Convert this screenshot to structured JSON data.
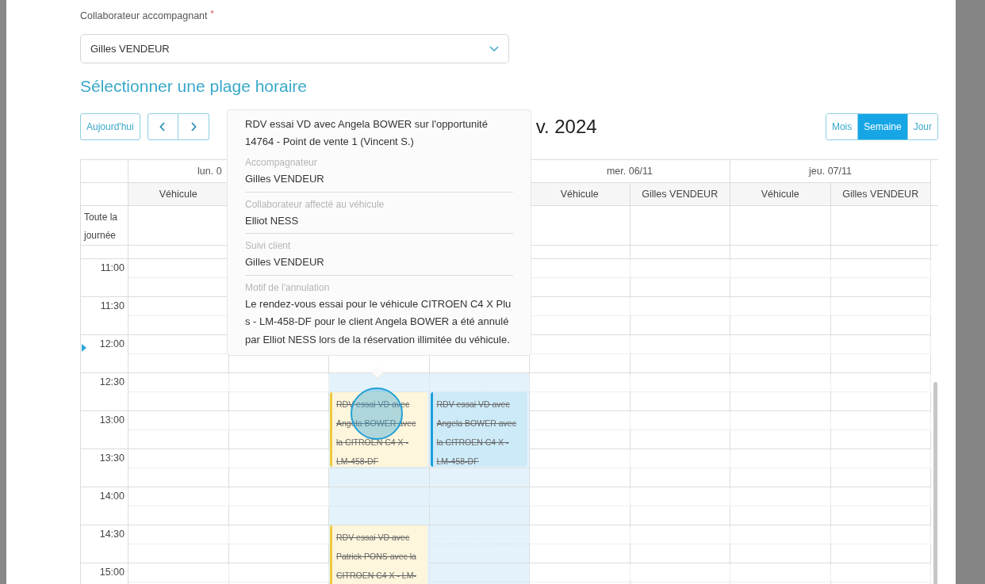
{
  "form": {
    "label": "Collaborateur accompagnant",
    "required_mark": "*",
    "select_value": "Gilles VENDEUR"
  },
  "heading": "Sélectionner une plage horaire",
  "toolbar": {
    "today_button": "Aujourd'hui",
    "title": "v. 2024",
    "views": [
      {
        "label": "Mois",
        "selected": false
      },
      {
        "label": "Semaine",
        "selected": true
      },
      {
        "label": "Jour",
        "selected": false
      }
    ]
  },
  "calendar": {
    "all_day_label": "Toute la journée",
    "days": [
      {
        "label": "lun. 0",
        "columns": [
          "Véhicule"
        ]
      },
      {
        "label": "mer. 06/11",
        "columns": [
          "Véhicule",
          "Gilles VENDEUR"
        ]
      },
      {
        "label": "jeu. 07/11",
        "columns": [
          "Véhicule",
          "Gilles VENDEUR"
        ]
      }
    ],
    "times": [
      "11:00",
      "11:30",
      "12:00",
      "12:30",
      "13:00",
      "13:30",
      "14:00",
      "14:30",
      "15:00"
    ],
    "events": [
      {
        "kind": "vehicle",
        "cancelled": true,
        "text": "RDV essai VD avec Angela BOWER avec la CITROEN C4 X - LM-458-DF"
      },
      {
        "kind": "collaborator",
        "cancelled": true,
        "text": "RDV essai VD avec Angela BOWER avec la CITROEN C4 X - LM-458-DF"
      },
      {
        "kind": "vehicle",
        "cancelled": true,
        "text": "RDV essai VD avec Patrick PONS avec la CITROEN C4 X - LM-"
      }
    ]
  },
  "popover": {
    "title": "RDV essai VD avec Angela BOWER sur l'opportunité 14764 - Point de vente 1 (Vincent S.)",
    "fields": [
      {
        "label": "Accompagnateur",
        "value": "Gilles VENDEUR"
      },
      {
        "label": "Collaborateur affecté au véhicule",
        "value": "Elliot NESS"
      },
      {
        "label": "Suivi client",
        "value": "Gilles VENDEUR"
      },
      {
        "label": "Motif de l'annulation",
        "value": "Le rendez-vous essai pour le véhicule CITROEN C4 X Plus - LM-458-DF pour le client Angela BOWER a été annulé par Elliot NESS lors de la réservation illimitée du véhicule."
      }
    ]
  }
}
